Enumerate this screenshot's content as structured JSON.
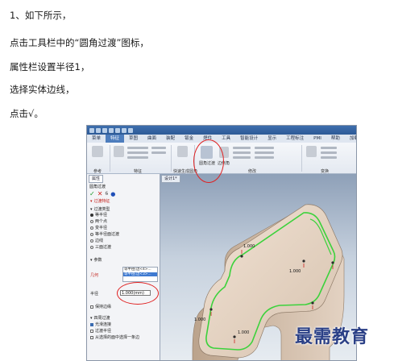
{
  "steps": [
    "1、如下所示，",
    "点击工具栏中的“圆角过渡”图标，",
    "属性栏设置半径1，",
    "选择实体边线，",
    "点击√。"
  ],
  "cad": {
    "menus": [
      "菜单",
      "特征",
      "草图",
      "曲面",
      "装配",
      "钣金",
      "焊件",
      "工具",
      "智能设计",
      "显示",
      "工程标注",
      "PMI",
      "帮助",
      "加载"
    ],
    "active_menu": "特征",
    "ribbon_groups": [
      "参考",
      "特征",
      "快速生成圆角",
      "修改",
      "变换"
    ],
    "ribbon_labels": {
      "fillet_tool": "圆角过渡",
      "edge_tool": "边倒角"
    },
    "panel": {
      "tab": "属性",
      "header": "圆角过渡",
      "sections": {
        "fillet_feature": "过渡特征",
        "fillet_type": "过渡类型",
        "params": "参数",
        "options": "选项"
      },
      "types": [
        {
          "label": "等半径",
          "checked": true
        },
        {
          "label": "两个点",
          "checked": false
        },
        {
          "label": "变半径",
          "checked": false
        },
        {
          "label": "等半径面过渡",
          "checked": false
        },
        {
          "label": "边线",
          "checked": false
        },
        {
          "label": "三面过渡",
          "checked": false
        }
      ],
      "geometry_label": "几何",
      "geometry_items": [
        "等半径[边<4>...",
        "等半径[边<3>..."
      ],
      "radius_label": "半径",
      "radius_value": "1.000(mm)",
      "extras": [
        {
          "label": "保持边缘",
          "checked": false
        },
        {
          "label": "光滑连接",
          "checked": true
        },
        {
          "label": "过渡半径",
          "checked": false
        },
        {
          "label": "从选择的面中选择一条边",
          "checked": false
        }
      ],
      "option_title": "四周过渡"
    },
    "viewport_tab": "设计1*",
    "edge_labels": [
      "1.000",
      "1.000",
      "1.000",
      "1.000"
    ]
  },
  "watermark": "最需教育",
  "colors": {
    "highlight_circle": "#e02020",
    "edge_selection": "#3cd23c",
    "active_tab": "#4d7dbd",
    "watermark": "#2a3f86"
  }
}
